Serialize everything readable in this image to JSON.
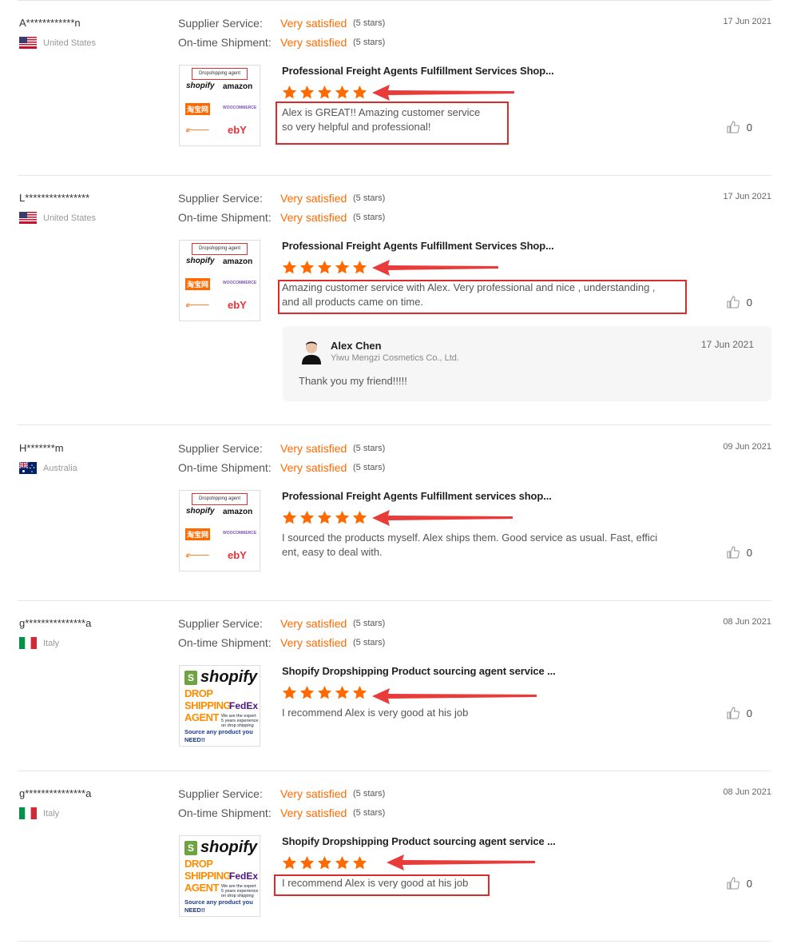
{
  "labels": {
    "supplier_service": "Supplier Service:",
    "ontime_shipment": "On-time Shipment:"
  },
  "colors": {
    "accent": "#ff6a00",
    "annotation_red": "#dd2a2a"
  },
  "thumbnail_text": {
    "dropshipping_agent": "Dropshipping agent",
    "shopify": "shopify",
    "amazon": "amazon",
    "taobao": "淘宝网",
    "woocommerce": "WOOCOMMERCE",
    "ebay": "ebY",
    "drop": "DROP",
    "shipping": "SHIPPING",
    "agent": "AGENT",
    "fedex": "FedEx",
    "we_are": "We are the expert",
    "years": "5 years experience",
    "on_drop": "on drop shipping",
    "source_any": "Source any product you",
    "need": "NEED!!"
  },
  "reviews": [
    {
      "username": "A************n",
      "country": "United States",
      "flag": "us-flag",
      "date": "17 Jun 2021",
      "supplier_service": "Very satisfied",
      "supplier_stars": "(5 stars)",
      "ontime_shipment": "Very satisfied",
      "ontime_stars": "(5 stars)",
      "product_title": "Professional Freight Agents Fulfillment Services Shop...",
      "rating": 5,
      "comment_lines": [
        "Alex is GREAT!! Amazing customer service",
        "so very helpful and professional!"
      ],
      "likes": "0"
    },
    {
      "username": "L****************",
      "country": "United States",
      "flag": "us-flag",
      "date": "17 Jun 2021",
      "supplier_service": "Very satisfied",
      "supplier_stars": "(5 stars)",
      "ontime_shipment": "Very satisfied",
      "ontime_stars": "(5 stars)",
      "product_title": "Professional Freight Agents Fulfillment Services Shop...",
      "rating": 5,
      "comment_lines": [
        "Amazing customer service with Alex. Very professional and nice , understanding ,",
        "and all products came on time."
      ],
      "likes": "0",
      "reply": {
        "name": "Alex Chen",
        "company": "Yiwu Mengzi Cosmetics Co., Ltd.",
        "date": "17 Jun 2021",
        "text": "Thank you my friend!!!!!"
      }
    },
    {
      "username": "H*******m",
      "country": "Australia",
      "flag": "au-flag",
      "date": "09 Jun 2021",
      "supplier_service": "Very satisfied",
      "supplier_stars": "(5 stars)",
      "ontime_shipment": "Very satisfied",
      "ontime_stars": "(5 stars)",
      "product_title": "Professional Freight Agents Fulfillment services shop...",
      "rating": 5,
      "comment_lines": [
        "I sourced the products myself. Alex ships them. Good service as usual. Fast, effici",
        "ent, easy to deal with."
      ],
      "likes": "0"
    },
    {
      "username": "g***************a",
      "country": "Italy",
      "flag": "it-flag",
      "date": "08 Jun 2021",
      "supplier_service": "Very satisfied",
      "supplier_stars": "(5 stars)",
      "ontime_shipment": "Very satisfied",
      "ontime_stars": "(5 stars)",
      "product_title": "Shopify Dropshipping Product sourcing agent service ...",
      "rating": 5,
      "comment_lines": [
        "I recommend Alex is very good at his job"
      ],
      "likes": "0"
    },
    {
      "username": "g***************a",
      "country": "Italy",
      "flag": "it-flag",
      "date": "08 Jun 2021",
      "supplier_service": "Very satisfied",
      "supplier_stars": "(5 stars)",
      "ontime_shipment": "Very satisfied",
      "ontime_stars": "(5 stars)",
      "product_title": "Shopify Dropshipping Product sourcing agent service ...",
      "rating": 5,
      "comment_lines": [
        "I recommend Alex is very good at his job"
      ],
      "likes": "0"
    }
  ]
}
